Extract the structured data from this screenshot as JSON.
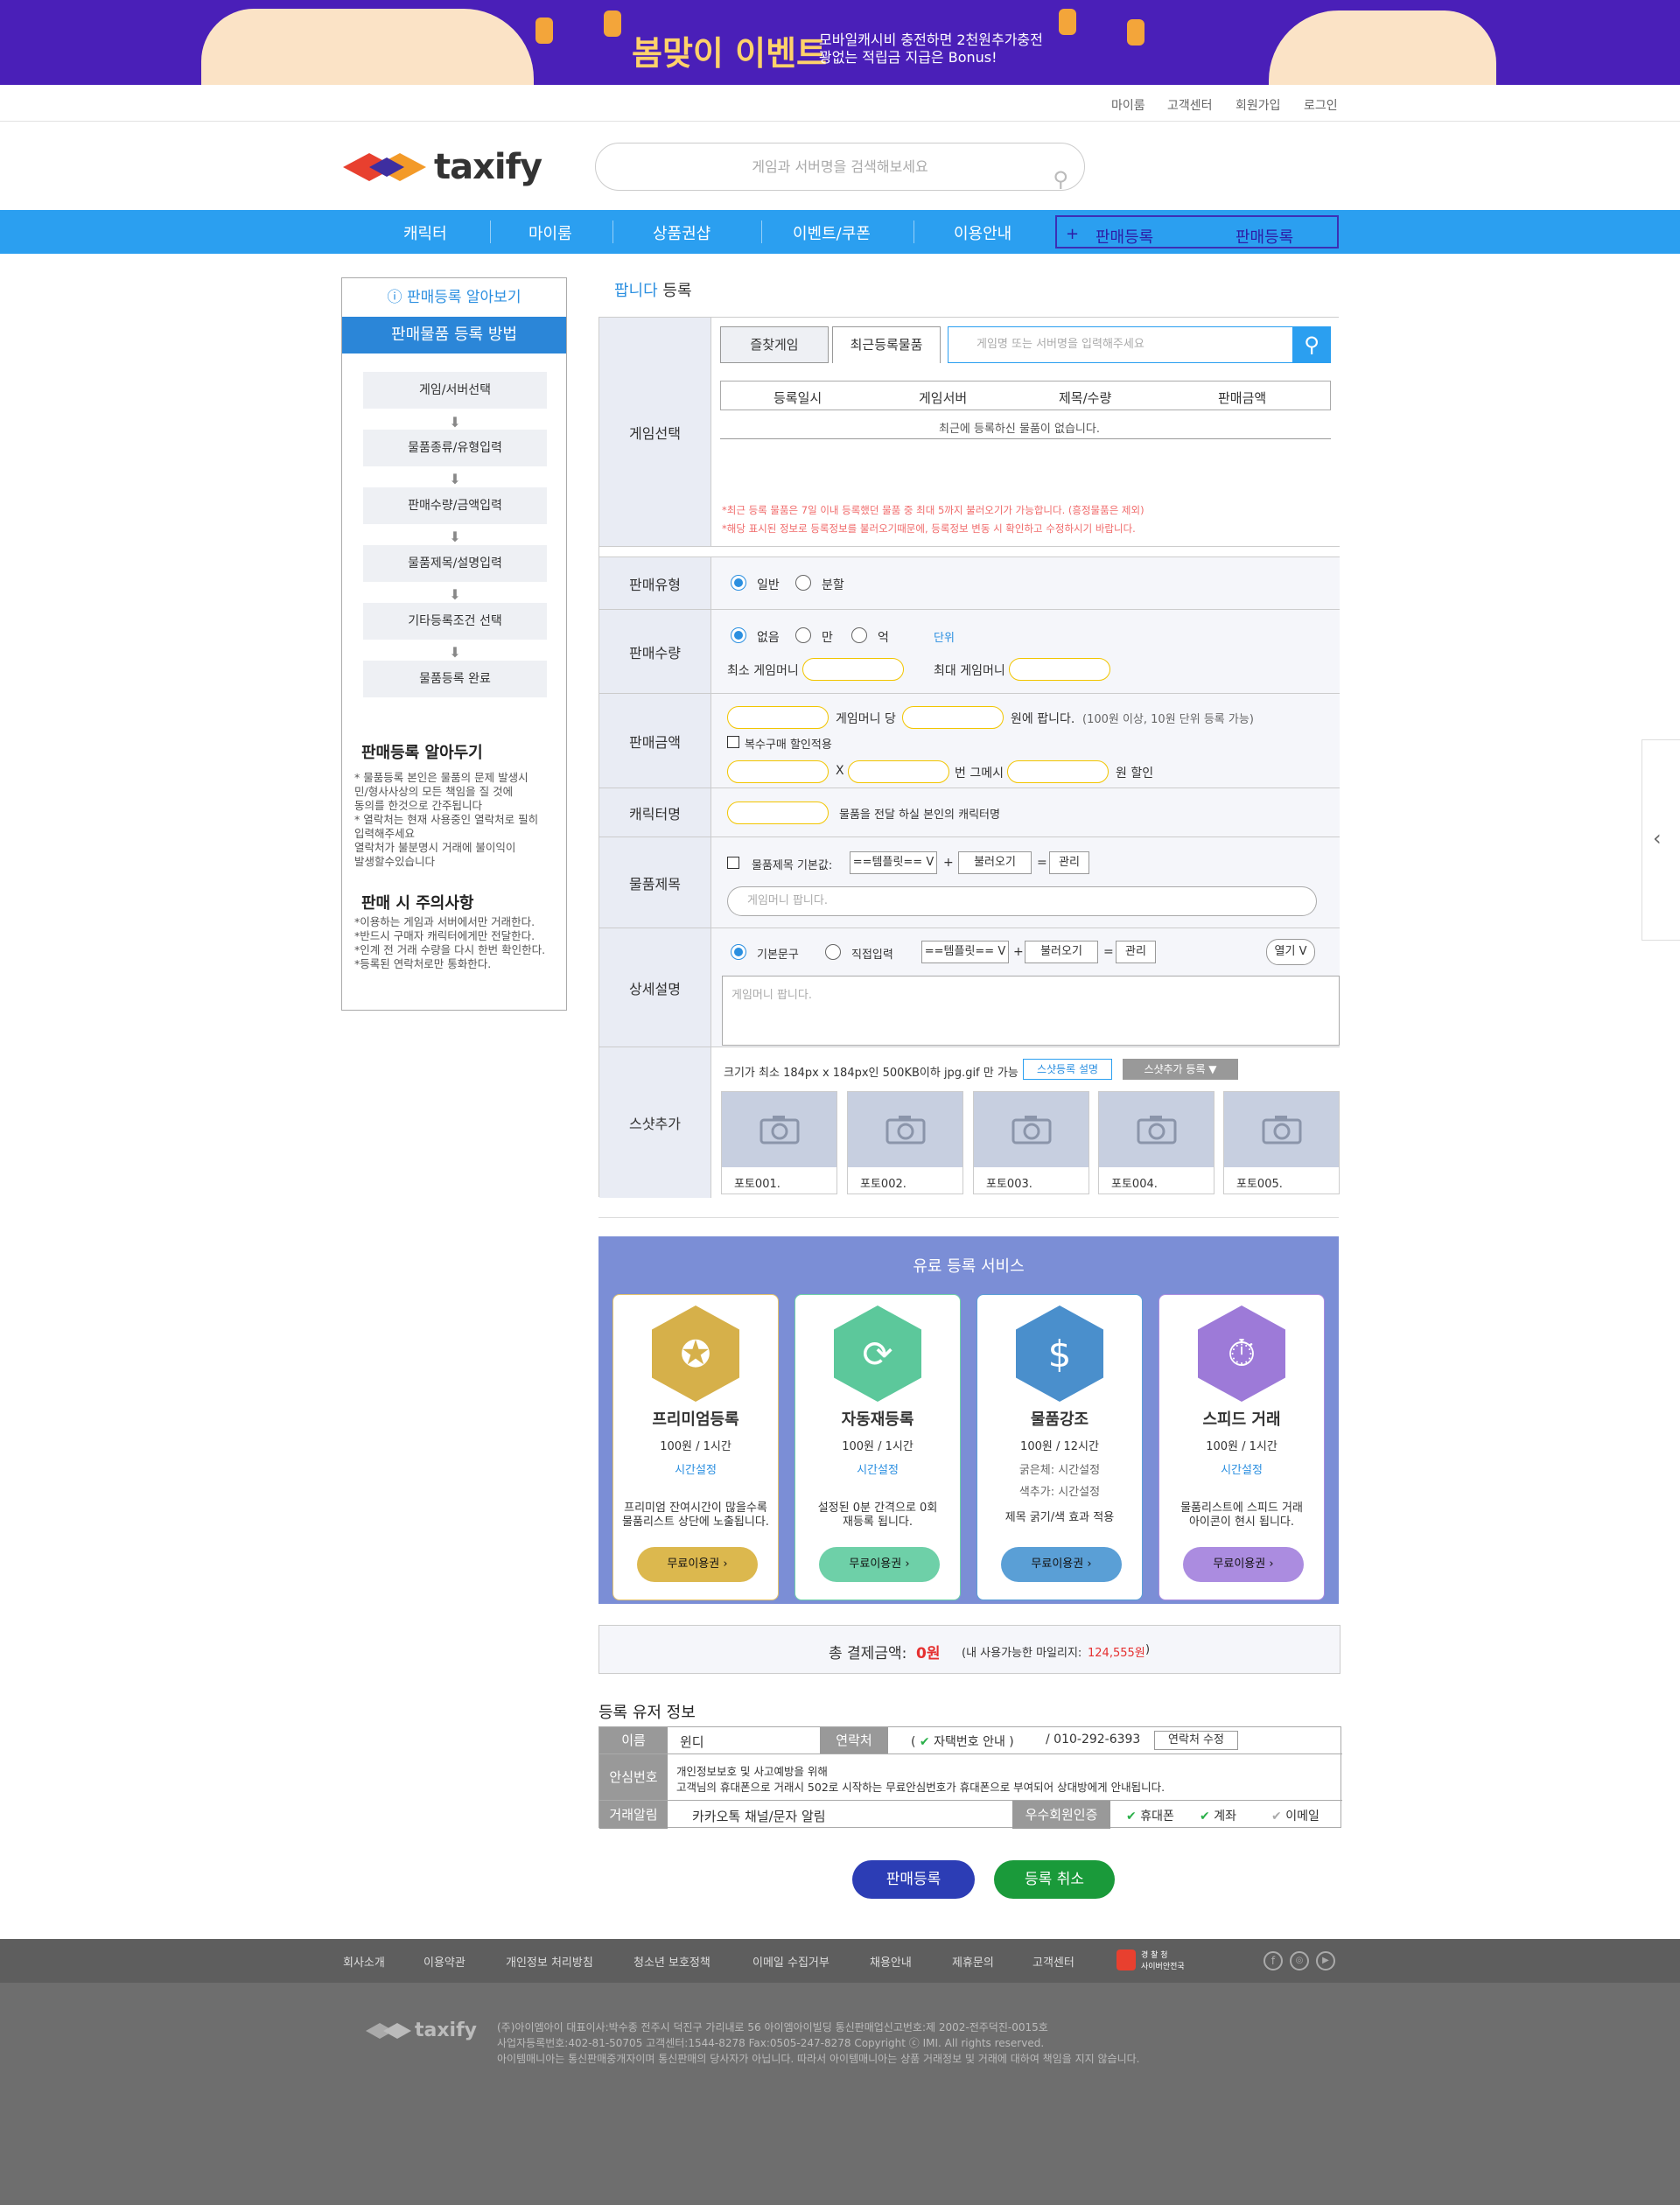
{
  "banner": {
    "title": "봄맞이 이벤트",
    "line1": "모바일캐시비 충전하면 2천원추가충전",
    "line2": "꽝없는 적립금 지급은 Bonus!"
  },
  "topnav": [
    "마이룸",
    "고객센터",
    "회원가입",
    "로그인"
  ],
  "logo": "taxify",
  "search": {
    "placeholder": "게임과 서버명을 검색해보세요"
  },
  "mainnav": [
    "캐릭터",
    "마이룸",
    "상품권샵",
    "이벤트/쿠폰",
    "이용안내"
  ],
  "navbox": {
    "plus": "+",
    "a": "판매등록",
    "b": "판매등록"
  },
  "side": {
    "header": "판매등록 알아보기",
    "subheader": "판매물품 등록 방법",
    "steps": [
      "게임/서버선택",
      "물품종류/유형입력",
      "판매수량/금액입력",
      "물품제목/설명입력",
      "기타등록조건 선택",
      "물품등록 완료"
    ],
    "know_title": "판매등록 알아두기",
    "know_lines": [
      "* 물품등록 본인은 물품의 문제 발생시",
      "  민/형사사상의 모든 책임을 질 것에",
      "  동의를 한것으로 간주됩니다",
      "* 열락처는 현재 사용중인 열락처로 필히",
      "  입력해주세요",
      "  열락처가 불분명시 거래에 불이익이",
      "  발생할수있습니다"
    ],
    "warn_title": "판매 시 주의사항",
    "warn_lines": [
      "*이용하는 게임과 서버에서만 거래한다.",
      "*반드시 구매자 캐릭터에게만 전달한다.",
      "*인계 전 거래 수량을 다시 한번 확인한다.",
      "*등록된 연락처로만 통화한다."
    ]
  },
  "page_title": {
    "a": "팝니다",
    "b": "등록"
  },
  "form": {
    "game": {
      "label": "게임선택",
      "tab1": "즐찾게임",
      "tab2": "최근등록물품",
      "search_placeholder": "게임명 또는 서버명을 입력해주세요",
      "cols": [
        "등록일시",
        "게임서버",
        "제목/수량",
        "판매금액"
      ],
      "empty": "최근에 등록하신 물품이 없습니다.",
      "note1": "*최근 등록 물품은 7일 이내 등록했던 물품 중 최대 5까지 불러오기가 가능합니다. (흥정물품은 제외)",
      "note2": "*해당 표시된 정보로 등록정보를 불러오기때문에, 등록정보 변동 시 확인하고 수정하시기 바랍니다."
    },
    "type": {
      "label": "판매유형",
      "opt1": "일반",
      "opt2": "분할"
    },
    "qty": {
      "label": "판매수량",
      "opt1": "없음",
      "opt2": "만",
      "opt3": "억",
      "unit": "단위",
      "min": "최소 게임머니",
      "max": "최대 게임머니"
    },
    "price": {
      "label": "판매금액",
      "per": "게임머니 당",
      "sell": "원에 팝니다.",
      "hint": "(100원 이상, 10원 단위 등록 가능)",
      "multi": "복수구매 할인적용",
      "x": "X",
      "times": "번 그메시",
      "discount": "원 할인"
    },
    "char": {
      "label": "캐릭터명",
      "desc": "물품을 전달 하실 본인의 캐릭터명"
    },
    "title": {
      "label": "물품제목",
      "base": "물품제목 기본값:",
      "tpl": "==템플릿== V",
      "plus": "+",
      "load": "불러오기",
      "eq": "=",
      "manage": "관리",
      "placeholder": "게임머니 팝니다."
    },
    "detail": {
      "label": "상세설명",
      "opt1": "기본문구",
      "opt2": "직접입력",
      "tpl": "==템플릿== V",
      "plus": "+",
      "load": "불러오기",
      "eq": "=",
      "manage": "관리",
      "open": "열기 V",
      "placeholder": "게임머니 팝니다."
    },
    "shot": {
      "label": "스샷추가",
      "hint": "크기가 최소 184px x 184px인 500KB이하 jpg.gif 만 가능",
      "help": "스샷등록 설명",
      "add": "스샷추가 등록 ▼",
      "photos": [
        "포토001.",
        "포토002.",
        "포토003.",
        "포토004.",
        "포토005."
      ]
    }
  },
  "paid": {
    "title": "유료 등록 서비스",
    "cards": [
      {
        "name": "프리미엄등록",
        "price": "100원 / 1시간",
        "set": "시간설정",
        "desc1": "프리미엄 잔여시간이 많을수록",
        "desc2": "물품리스트 상단에 노출됩니다.",
        "btn": "무료이용권",
        "color": "#dcb84e"
      },
      {
        "name": "자동재등록",
        "price": "100원 / 1시간",
        "set": "시간설정",
        "desc1": "설정된 0분 간격으로 0회",
        "desc2": "재등록 됩니다.",
        "btn": "무료이용권",
        "color": "#6ed0a8"
      },
      {
        "name": "물품강조",
        "price": "100원 / 12시간",
        "set": "굵은체: 시간설정",
        "set2": "색추가: 시간설정",
        "desc1": "제목 굵기/색 효과 적용",
        "desc2": "",
        "btn": "무료이용권",
        "color": "#5a9fd6"
      },
      {
        "name": "스피드 거래",
        "price": "100원 / 1시간",
        "set": "시간설정",
        "desc1": "물품리스트에 스피드 거래",
        "desc2": "아이콘이 현시 됩니다.",
        "btn": "무료이용권",
        "color": "#ab8ce0"
      }
    ]
  },
  "total": {
    "label": "총 결제금액:",
    "amount": "0원",
    "mileage": "(내 사용가능한 마일리지:",
    "mileage_val": "124,555원",
    ")": ")"
  },
  "user": {
    "title": "등록 유저 정보",
    "name_label": "이름",
    "name": "윈디",
    "contact_label": "연락처",
    "contact": "자택번호 안내",
    "phone": "/ 010-292-6393",
    "edit": "연락처 수정",
    "safe_label": "안심번호",
    "safe1": "개인정보보호 및 사고예방을 위해",
    "safe2": "고객님의 휴대폰으로 거래시 502로 시작하는 무료안심번호가 휴대폰으로 부여되어 상대방에게 안내됩니다.",
    "notify_label": "거래알림",
    "notify": "카카오톡 채널/문자 알림",
    "cert_label": "우수회원인증",
    "cert": [
      "휴대폰",
      "계좌",
      "이메일"
    ]
  },
  "buttons": {
    "submit": "판매등록",
    "cancel": "등록 취소"
  },
  "footer": {
    "links": [
      "회사소개",
      "이용약관",
      "개인정보 처리방침",
      "청소년 보호정책",
      "이메일 수집거부",
      "채용안내",
      "제휴문의",
      "고객센터"
    ],
    "police": "경 찰 청",
    "police2": "사이버안전국",
    "logo": "taxify",
    "l1": "(주)아이엠아이 대표이사:박수종 전주시 덕진구 가리내로 56 아이엠아이빌딩 통신판매업신고번호:제 2002-전주덕진-0015호",
    "l2": "사업자등록번호:402-81-50705 고객센터:1544-8278 Fax:0505-247-8278 Copyright ⓒ IMI. All rights reserved.",
    "l3": "아이템매니아는 통신판매중개자이며 통신판매의 당사자가 아닙니다. 따라서 아이템매니아는 상품 거래정보 및 거래에 대하여 책임을 지지 않습니다."
  }
}
